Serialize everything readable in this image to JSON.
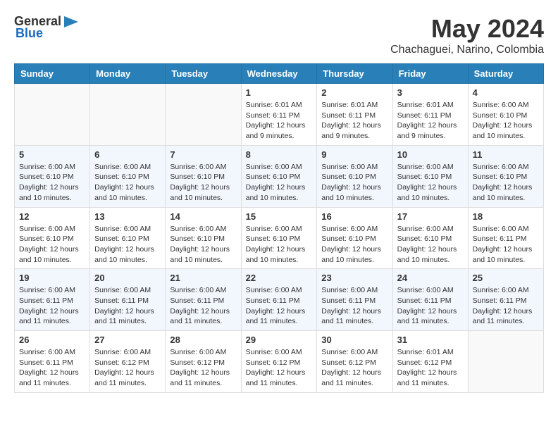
{
  "header": {
    "logo_general": "General",
    "logo_blue": "Blue",
    "month_year": "May 2024",
    "location": "Chachaguei, Narino, Colombia"
  },
  "weekdays": [
    "Sunday",
    "Monday",
    "Tuesday",
    "Wednesday",
    "Thursday",
    "Friday",
    "Saturday"
  ],
  "weeks": [
    [
      {
        "day": "",
        "info": ""
      },
      {
        "day": "",
        "info": ""
      },
      {
        "day": "",
        "info": ""
      },
      {
        "day": "1",
        "info": "Sunrise: 6:01 AM\nSunset: 6:11 PM\nDaylight: 12 hours\nand 9 minutes."
      },
      {
        "day": "2",
        "info": "Sunrise: 6:01 AM\nSunset: 6:11 PM\nDaylight: 12 hours\nand 9 minutes."
      },
      {
        "day": "3",
        "info": "Sunrise: 6:01 AM\nSunset: 6:11 PM\nDaylight: 12 hours\nand 9 minutes."
      },
      {
        "day": "4",
        "info": "Sunrise: 6:00 AM\nSunset: 6:10 PM\nDaylight: 12 hours\nand 10 minutes."
      }
    ],
    [
      {
        "day": "5",
        "info": "Sunrise: 6:00 AM\nSunset: 6:10 PM\nDaylight: 12 hours\nand 10 minutes."
      },
      {
        "day": "6",
        "info": "Sunrise: 6:00 AM\nSunset: 6:10 PM\nDaylight: 12 hours\nand 10 minutes."
      },
      {
        "day": "7",
        "info": "Sunrise: 6:00 AM\nSunset: 6:10 PM\nDaylight: 12 hours\nand 10 minutes."
      },
      {
        "day": "8",
        "info": "Sunrise: 6:00 AM\nSunset: 6:10 PM\nDaylight: 12 hours\nand 10 minutes."
      },
      {
        "day": "9",
        "info": "Sunrise: 6:00 AM\nSunset: 6:10 PM\nDaylight: 12 hours\nand 10 minutes."
      },
      {
        "day": "10",
        "info": "Sunrise: 6:00 AM\nSunset: 6:10 PM\nDaylight: 12 hours\nand 10 minutes."
      },
      {
        "day": "11",
        "info": "Sunrise: 6:00 AM\nSunset: 6:10 PM\nDaylight: 12 hours\nand 10 minutes."
      }
    ],
    [
      {
        "day": "12",
        "info": "Sunrise: 6:00 AM\nSunset: 6:10 PM\nDaylight: 12 hours\nand 10 minutes."
      },
      {
        "day": "13",
        "info": "Sunrise: 6:00 AM\nSunset: 6:10 PM\nDaylight: 12 hours\nand 10 minutes."
      },
      {
        "day": "14",
        "info": "Sunrise: 6:00 AM\nSunset: 6:10 PM\nDaylight: 12 hours\nand 10 minutes."
      },
      {
        "day": "15",
        "info": "Sunrise: 6:00 AM\nSunset: 6:10 PM\nDaylight: 12 hours\nand 10 minutes."
      },
      {
        "day": "16",
        "info": "Sunrise: 6:00 AM\nSunset: 6:10 PM\nDaylight: 12 hours\nand 10 minutes."
      },
      {
        "day": "17",
        "info": "Sunrise: 6:00 AM\nSunset: 6:10 PM\nDaylight: 12 hours\nand 10 minutes."
      },
      {
        "day": "18",
        "info": "Sunrise: 6:00 AM\nSunset: 6:11 PM\nDaylight: 12 hours\nand 10 minutes."
      }
    ],
    [
      {
        "day": "19",
        "info": "Sunrise: 6:00 AM\nSunset: 6:11 PM\nDaylight: 12 hours\nand 11 minutes."
      },
      {
        "day": "20",
        "info": "Sunrise: 6:00 AM\nSunset: 6:11 PM\nDaylight: 12 hours\nand 11 minutes."
      },
      {
        "day": "21",
        "info": "Sunrise: 6:00 AM\nSunset: 6:11 PM\nDaylight: 12 hours\nand 11 minutes."
      },
      {
        "day": "22",
        "info": "Sunrise: 6:00 AM\nSunset: 6:11 PM\nDaylight: 12 hours\nand 11 minutes."
      },
      {
        "day": "23",
        "info": "Sunrise: 6:00 AM\nSunset: 6:11 PM\nDaylight: 12 hours\nand 11 minutes."
      },
      {
        "day": "24",
        "info": "Sunrise: 6:00 AM\nSunset: 6:11 PM\nDaylight: 12 hours\nand 11 minutes."
      },
      {
        "day": "25",
        "info": "Sunrise: 6:00 AM\nSunset: 6:11 PM\nDaylight: 12 hours\nand 11 minutes."
      }
    ],
    [
      {
        "day": "26",
        "info": "Sunrise: 6:00 AM\nSunset: 6:11 PM\nDaylight: 12 hours\nand 11 minutes."
      },
      {
        "day": "27",
        "info": "Sunrise: 6:00 AM\nSunset: 6:12 PM\nDaylight: 12 hours\nand 11 minutes."
      },
      {
        "day": "28",
        "info": "Sunrise: 6:00 AM\nSunset: 6:12 PM\nDaylight: 12 hours\nand 11 minutes."
      },
      {
        "day": "29",
        "info": "Sunrise: 6:00 AM\nSunset: 6:12 PM\nDaylight: 12 hours\nand 11 minutes."
      },
      {
        "day": "30",
        "info": "Sunrise: 6:00 AM\nSunset: 6:12 PM\nDaylight: 12 hours\nand 11 minutes."
      },
      {
        "day": "31",
        "info": "Sunrise: 6:01 AM\nSunset: 6:12 PM\nDaylight: 12 hours\nand 11 minutes."
      },
      {
        "day": "",
        "info": ""
      }
    ]
  ]
}
